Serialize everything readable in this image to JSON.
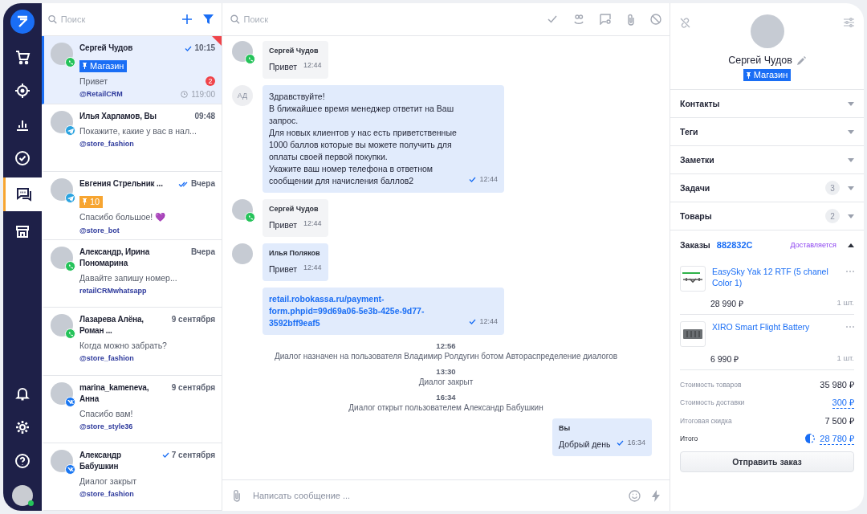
{
  "nav": {
    "top": [
      {
        "kind": "cart",
        "selected": false
      },
      {
        "kind": "target",
        "selected": false
      },
      {
        "kind": "chart",
        "selected": false
      },
      {
        "kind": "check",
        "selected": false
      },
      {
        "kind": "chat",
        "selected": true
      },
      {
        "kind": "store",
        "selected": false
      }
    ],
    "bottom": [
      {
        "kind": "bell"
      },
      {
        "kind": "gear"
      },
      {
        "kind": "help"
      },
      {
        "kind": "user",
        "online": true
      }
    ]
  },
  "chat_list": {
    "search": {
      "placeholder": "Поиск"
    },
    "chats": [
      {
        "name": "Сергей Чудов",
        "kind": "whatsapp",
        "delivered": true,
        "read": false,
        "time": "10:15",
        "tag": {
          "text": "Магазин",
          "color": "#1a6ef5"
        },
        "preview": "Привет",
        "unread": "2",
        "source": "@RetailCRM",
        "timer": "119:00",
        "selected": true,
        "flagged": true
      },
      {
        "name": "Илья Харламов, Вы",
        "kind": "telegram",
        "delivered": false,
        "read": false,
        "time": "09:48",
        "preview": "Покажите, какие у вас в нал...",
        "source": "@store_fashion",
        "selected": false,
        "flagged": false
      },
      {
        "name": "Евгения Стрельник ...",
        "kind": "telegram",
        "delivered": true,
        "read": true,
        "time": "Вчера",
        "tag": {
          "text": "10",
          "color": "#f7a531"
        },
        "preview": "Спасибо большое! 💜",
        "source": "@store_bot",
        "selected": false,
        "flagged": false
      },
      {
        "name": "Александр, Ирина Пономарина",
        "kind": "whatsapp",
        "delivered": false,
        "read": false,
        "time": "Вчера",
        "preview": "Давайте запишу номер...",
        "source": "retailCRMwhatsapp",
        "selected": false,
        "flagged": false
      },
      {
        "name": "Лазарева Алёна, Роман ...",
        "kind": "whatsapp",
        "delivered": false,
        "read": false,
        "time": "9 сентября",
        "preview": "Когда можно забрать?",
        "source": "@store_fashion",
        "selected": false,
        "flagged": false
      },
      {
        "name": "marina_kameneva, Анна",
        "kind": "vk",
        "delivered": false,
        "read": false,
        "time": "9 сентября",
        "preview": "Спасибо вам!",
        "source": "@store_style36",
        "selected": false,
        "flagged": false
      },
      {
        "name": "Александр Бабушкин",
        "kind": "vk",
        "delivered": true,
        "read": false,
        "time": "7 сентября",
        "preview": "Диалог закрыт",
        "source": "@store_fashion",
        "selected": false,
        "flagged": false
      }
    ]
  },
  "chat": {
    "search": {
      "placeholder": "Поиск"
    },
    "messages": [
      {
        "kind": "client",
        "photo": true,
        "badge": true,
        "author": "Сергей Чудов",
        "text": "Привет",
        "time": "12:44",
        "checked": false
      },
      {
        "kind": "staff",
        "photo": false,
        "badge": false,
        "initials": "АД",
        "text": "Здравствуйте!\nВ ближайшее время менеджер ответит на Ваш запрос.\nДля новых клиентов у нас есть приветственные  1000 баллов которые вы можете получить для оплаты своей первой покупки.\nУкажите ваш номер телефона в ответном сообщении для начисления баллов2",
        "time": "12:44",
        "checked": true
      },
      {
        "kind": "client",
        "photo": true,
        "badge": true,
        "author": "Сергей Чудов",
        "text": "Привет",
        "time": "12:44",
        "checked": false
      },
      {
        "kind": "staff",
        "photo": true,
        "badge": false,
        "author": "Илья Поляков",
        "text": "Привет",
        "time": "12:44",
        "checked": false
      },
      {
        "kind": "staff",
        "photo": false,
        "badge": false,
        "link": "retail.robokassa.ru/payment-form.phpid=99d69a06-5e3b-425e-9d77-3592bff9eaf5",
        "time": "12:44",
        "checked": true
      },
      {
        "kind": "system",
        "time": "12:56",
        "text": "Диалог назначен на пользователя Владимир Ролдугин ботом Автораспределение диалогов"
      },
      {
        "kind": "system",
        "time": "13:30",
        "text": "Диалог закрыт"
      },
      {
        "kind": "system",
        "time": "16:34",
        "text": "Диалог открыт пользователем Александр Бабушкин"
      },
      {
        "kind": "outgoing",
        "photo": false,
        "badge": false,
        "author": "Вы",
        "text": "Добрый день",
        "time": "16:34",
        "checked": true
      }
    ],
    "composer": {
      "placeholder": "Написать сообщение ..."
    }
  },
  "customer": {
    "name": "Сергей Чудов",
    "tag": "Магазин",
    "sections": [
      {
        "title": "Контакты",
        "expanded": false
      },
      {
        "title": "Теги",
        "expanded": false
      },
      {
        "title": "Заметки",
        "expanded": false
      },
      {
        "title": "Задачи",
        "count": "3",
        "expanded": false
      },
      {
        "title": "Товары",
        "count": "2",
        "expanded": false
      }
    ],
    "orders": {
      "title": "Заказы",
      "number": "882832C",
      "status": "Доставляется",
      "expanded": true,
      "items": [
        {
          "name": "EasySky Yak 12 RTF (5 chanel Color 1)",
          "kind": "drone",
          "price": "28 990 ₽",
          "qty": "1 шт."
        },
        {
          "name": "XIRO Smart Flight Battery",
          "kind": "battery",
          "price": "6 990 ₽",
          "qty": "1 шт."
        }
      ],
      "totals": [
        {
          "label": "Стоимость товаров",
          "value": "35 980 ₽",
          "link": false,
          "bonus": false
        },
        {
          "label": "Стоимость доставки",
          "value": "300 ₽",
          "link": true,
          "bonus": false
        },
        {
          "label": "Итоговая скидка",
          "value": "7 500 ₽",
          "link": false,
          "bonus": false
        },
        {
          "label": "Итого",
          "value": "28 780 ₽",
          "link": true,
          "bonus": true
        }
      ],
      "button": "Отправить заказ"
    }
  }
}
